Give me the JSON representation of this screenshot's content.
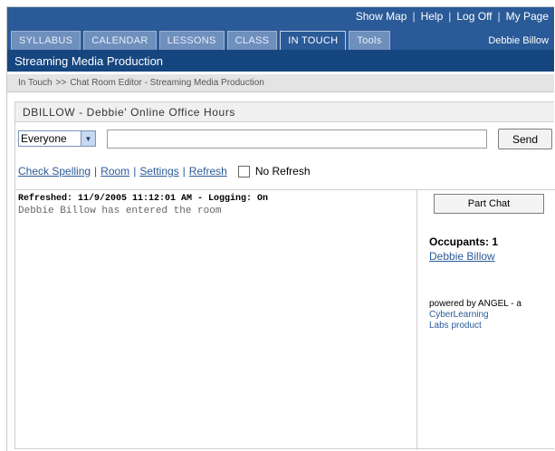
{
  "toplinks": [
    "Show Map",
    "Help",
    "Log Off",
    "My Page"
  ],
  "tabs": [
    {
      "label": "SYLLABUS",
      "active": false
    },
    {
      "label": "CALENDAR",
      "active": false
    },
    {
      "label": "LESSONS",
      "active": false
    },
    {
      "label": "CLASS",
      "active": false
    },
    {
      "label": "IN TOUCH",
      "active": true
    },
    {
      "label": "Tools",
      "active": false
    }
  ],
  "user": "Debbie Billow",
  "course_title": "Streaming Media Production",
  "breadcrumb": {
    "root": "In Touch",
    "separator": ">>",
    "current": "Chat Room Editor - Streaming Media Production"
  },
  "room_title": "DBILLOW - Debbie' Online Office Hours",
  "recipient_select": {
    "value": "Everyone"
  },
  "message_input": {
    "value": "",
    "placeholder": ""
  },
  "send_label": "Send",
  "actions": [
    "Check Spelling",
    "Room",
    "Settings",
    "Refresh"
  ],
  "no_refresh_label": "No Refresh",
  "chat": {
    "status_line": "Refreshed: 11/9/2005 11:12:01 AM - Logging: On",
    "messages": [
      "Debbie Billow has entered the room"
    ]
  },
  "side": {
    "part_button": "Part Chat",
    "occupants_label": "Occupants: 1",
    "occupants": [
      "Debbie Billow"
    ],
    "powered_by": "powered by ANGEL - a",
    "powered_link1": "CyberLearning",
    "powered_link2": "Labs product"
  },
  "colors": {
    "primary": "#2a5a97",
    "dark": "#16467f",
    "tab": "#6f8fbd"
  }
}
